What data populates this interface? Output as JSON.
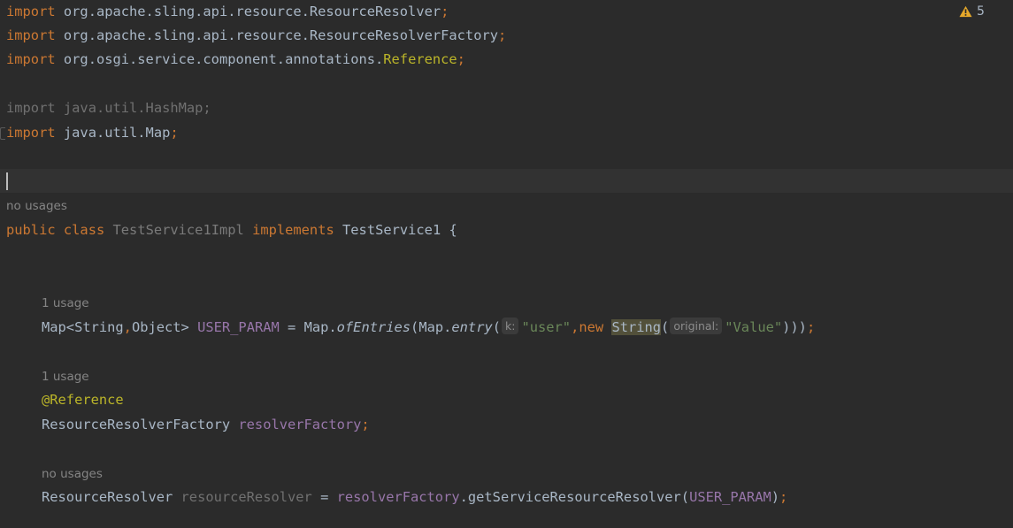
{
  "editor": {
    "warnings": {
      "count": "5",
      "icon": "warning-icon",
      "color": "#e6a82a"
    },
    "imports": [
      {
        "keyword": "import",
        "path": "org.apache.sling.api.resource.ResourceResolver",
        "semi": ";"
      },
      {
        "keyword": "import",
        "path": "org.apache.sling.api.resource.ResourceResolverFactory",
        "semi": ";"
      },
      {
        "keyword": "import",
        "path_prefix": "org.osgi.service.component.annotations.",
        "path_last": "Reference",
        "semi": ";"
      },
      {
        "keyword": "import",
        "path": "java.util.HashMap",
        "semi": ";"
      },
      {
        "keyword": "import",
        "path": "java.util.Map",
        "semi": ";"
      }
    ],
    "class_decl": {
      "hint": "no usages",
      "public": "public",
      "class": "class",
      "name": "TestService1Impl",
      "implements": "implements",
      "interface": "TestService1",
      "brace": " {"
    },
    "field1": {
      "hint": "1 usage",
      "type": "Map<String",
      "comma": ",",
      "type2": "Object> ",
      "name": "USER_PARAM",
      "eq": " = Map.",
      "method1": "ofEntries",
      "paren1": "(Map.",
      "method2": "entry",
      "paren2": "(",
      "inlay_k": "k:",
      "str1": "\"user\"",
      "comma2": ",",
      "new": "new ",
      "string_cls": "String",
      "paren3": "(",
      "inlay_original": "original:",
      "str2": "\"Value\"",
      "close": ")))",
      "semi": ";"
    },
    "field2": {
      "hint": "1 usage",
      "annotation": "@Reference",
      "type": "ResourceResolverFactory ",
      "name": "resolverFactory",
      "semi": ";"
    },
    "field3": {
      "hint": "no usages",
      "type": "ResourceResolver ",
      "name": "resourceResolver",
      "eq": " = ",
      "obj": "resolverFactory",
      "call": ".getServiceResourceResolver(",
      "arg": "USER_PARAM",
      "close": ")",
      "semi": ";"
    }
  }
}
